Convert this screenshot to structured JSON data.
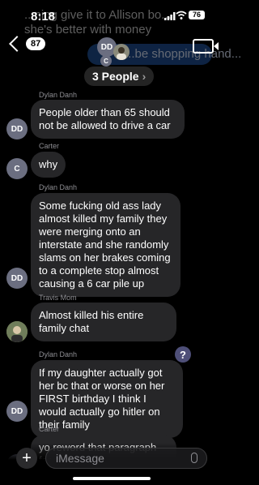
{
  "status_bar": {
    "time": "8:18",
    "battery": "76"
  },
  "background_preview": {
    "line1": "...ning give it to Allison bo...",
    "line2": "she's better with money",
    "right_bubble": "...be shopping hand..."
  },
  "header": {
    "unread_count": "87",
    "avatar_initials": "DD",
    "avatar_small_initials": "C",
    "group_name": "3 People",
    "chevron": "›"
  },
  "messages": [
    {
      "sender": "Dylan Danh",
      "avatar": "DD",
      "text": "People older than 65 should not be allowed to drive a car"
    },
    {
      "sender": "Carter",
      "avatar": "C",
      "text": "why"
    },
    {
      "sender": "Dylan Danh",
      "avatar": "DD",
      "text": "Some fucking old ass lady almost killed my family they were merging onto an interstate and she randomly slams on her brakes coming to a complete stop almost causing a 6 car pile up"
    },
    {
      "sender": "Travis Mom",
      "avatar": "",
      "text": "Almost killed his entire family chat"
    },
    {
      "sender": "Dylan Danh",
      "avatar": "DD",
      "text": "If my daughter actually got her bc that or worse on her FIRST birthday I think I would actually go hitler on their family"
    },
    {
      "sender": "Carter",
      "avatar": "C",
      "text": "yo reword that paragraph for us"
    }
  ],
  "reaction": "?",
  "composer": {
    "plus": "+",
    "placeholder": "iMessage"
  },
  "icons": {
    "back": "chevron-left-icon",
    "video": "video-camera-icon",
    "mic": "microphone-icon"
  }
}
